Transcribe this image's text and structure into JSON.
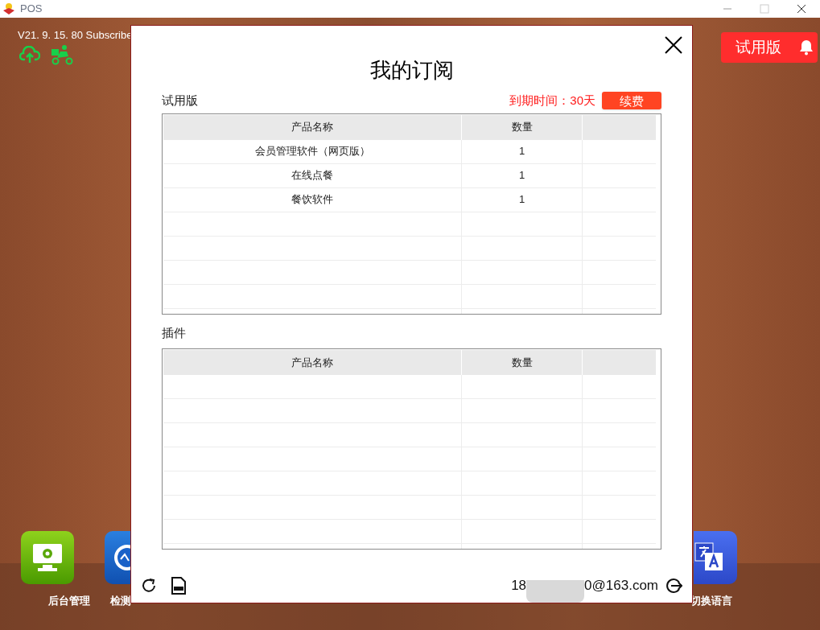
{
  "window": {
    "title": "POS"
  },
  "version": "V21. 9. 15. 80 Subscribe",
  "trial_badge": {
    "label": "试用版"
  },
  "dock": [
    {
      "label": "后台管理",
      "kind": "admin"
    },
    {
      "label": "检测",
      "kind": "check"
    },
    {
      "label": "切换语言",
      "kind": "language"
    }
  ],
  "dialog": {
    "title": "我的订阅",
    "plan": {
      "label": "试用版",
      "expiry": "到期时间：30天",
      "renew_button": "续费",
      "columns": [
        "产品名称",
        "数量"
      ],
      "rows": [
        [
          "会员管理软件（网页版）",
          "1"
        ],
        [
          "在线点餐",
          "1"
        ],
        [
          "餐饮软件",
          "1"
        ]
      ]
    },
    "plugins": {
      "label": "插件",
      "columns": [
        "产品名称",
        "数量"
      ]
    },
    "account": {
      "email_start": "18",
      "email_end": "0@163.com"
    }
  }
}
